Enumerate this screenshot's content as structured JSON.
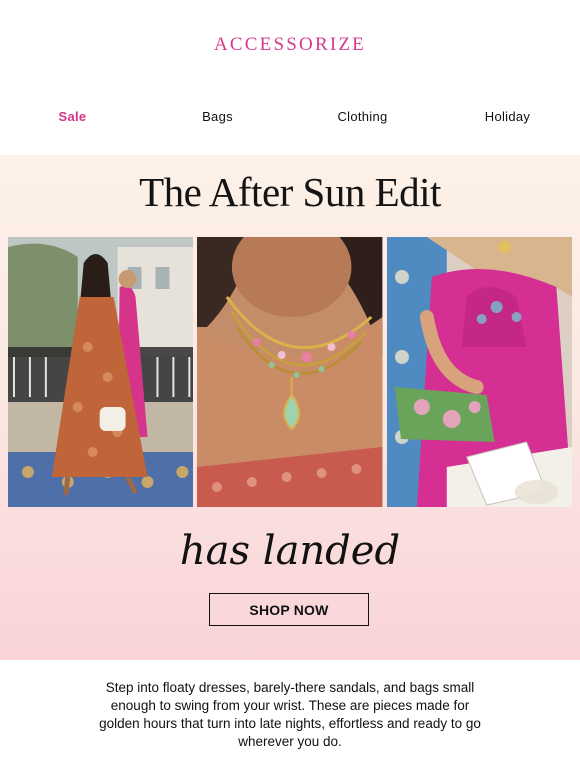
{
  "brand": {
    "name": "ACCESSORIZE",
    "color": "#d63a8a"
  },
  "nav": {
    "items": [
      {
        "label": "Sale",
        "highlight": true
      },
      {
        "label": "Bags",
        "highlight": false
      },
      {
        "label": "Clothing",
        "highlight": false
      },
      {
        "label": "Holiday",
        "highlight": false
      }
    ]
  },
  "hero": {
    "title": "The After Sun Edit",
    "subtitle": "has landed",
    "cta": "SHOP NOW",
    "images": [
      {
        "name": "woman-in-orange-dress-photo"
      },
      {
        "name": "gemstone-necklace-photo"
      },
      {
        "name": "pink-dress-clutch-bag-photo"
      }
    ]
  },
  "body_copy": "Step into floaty dresses, barely-there sandals, and bags small enough to swing from your wrist. These are pieces made for golden hours that turn into late nights, effortless and ready to go wherever you do."
}
